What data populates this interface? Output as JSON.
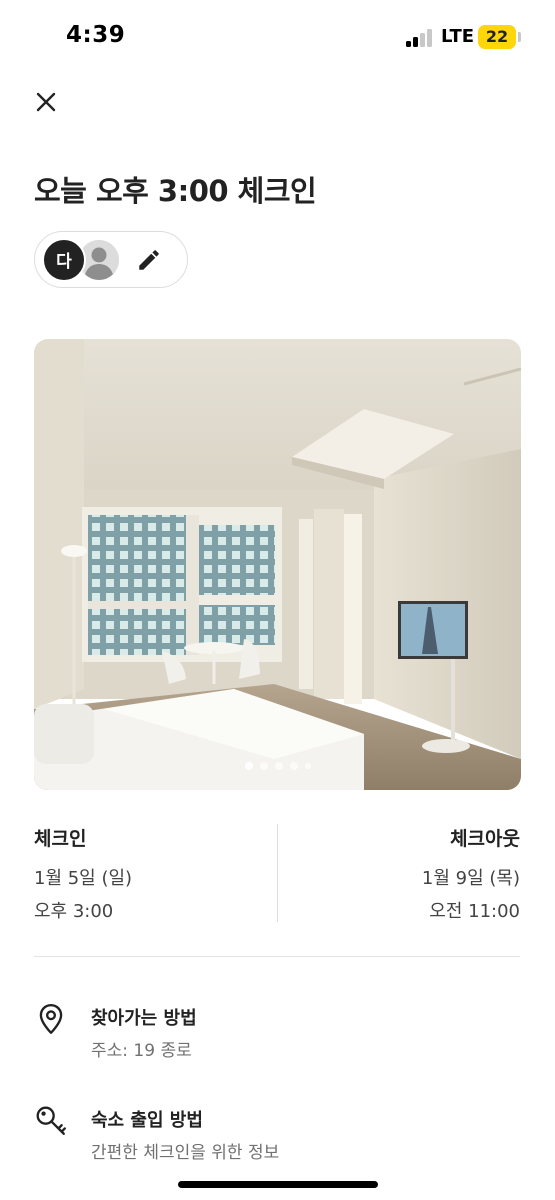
{
  "status_bar": {
    "time": "4:39",
    "network": "LTE",
    "battery": "22",
    "battery_color": "#ffd60a"
  },
  "header": {
    "close_icon": "close-icon",
    "title": "오늘 오후 3:00 체크인"
  },
  "guests": {
    "initial": "다",
    "edit_icon": "pencil-icon"
  },
  "photo": {
    "carousel_total_dots": 5,
    "active_index": 0
  },
  "checkin": {
    "label": "체크인",
    "date": "1월 5일 (일)",
    "time": "오후 3:00"
  },
  "checkout": {
    "label": "체크아웃",
    "date": "1월 9일 (목)",
    "time": "오전 11:00"
  },
  "info_rows": [
    {
      "icon": "map-pin-icon",
      "title": "찾아가는 방법",
      "subtitle": "주소: 19 종로"
    },
    {
      "icon": "key-icon",
      "title": "숙소 출입 방법",
      "subtitle": "간편한 체크인을 위한 정보"
    }
  ],
  "colors": {
    "text": "#222222",
    "muted": "#717171",
    "border": "#dddddd"
  }
}
